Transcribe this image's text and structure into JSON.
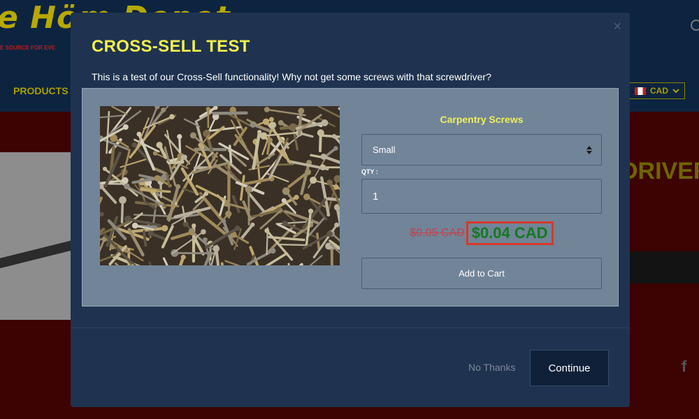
{
  "store": {
    "logo_text": "e Höm Depot",
    "tagline": "E SOURCE FOR EVE",
    "nav_label": "PRODUCTS",
    "currency": "CAD",
    "product_title_partial": "DRIVER"
  },
  "modal": {
    "close_glyph": "×",
    "title": "CROSS-SELL TEST",
    "description": "This is a test of our Cross-Sell functionality! Why not get some screws with that screwdriver?",
    "product": {
      "name": "Carpentry Screws",
      "variant": "Small",
      "qty_label": "QTY :",
      "qty_value": "1",
      "price_original": "$0.05 CAD",
      "price_sale": "$0.04 CAD",
      "add_to_cart_label": "Add to Cart"
    },
    "no_thanks_label": "No Thanks",
    "continue_label": "Continue"
  },
  "colors": {
    "modal_bg": "#1f3350",
    "panel_bg": "#728498",
    "title_yellow": "#f2f24a",
    "sale_green": "#137a1f",
    "old_price_red": "#c2424e",
    "highlight_red": "#d63a2a"
  }
}
